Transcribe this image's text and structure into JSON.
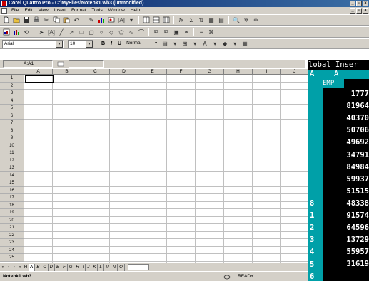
{
  "window": {
    "title": "Corel Quattro Pro - C:\\MyFiles\\Notebk1.wb3 (unmodified)"
  },
  "menu": [
    "File",
    "Edit",
    "View",
    "Insert",
    "Format",
    "Tools",
    "Window",
    "Help"
  ],
  "font_bar": {
    "font": "Arial",
    "size": "10",
    "bold": "B",
    "italic": "I",
    "underline": "U",
    "style": "Normal"
  },
  "input_line": {
    "cell_ref": "A:A1",
    "value": ""
  },
  "columns": [
    "A",
    "B",
    "C",
    "D",
    "E",
    "F",
    "G",
    "H",
    "I",
    "J"
  ],
  "rows": [
    "1",
    "2",
    "3",
    "4",
    "5",
    "6",
    "7",
    "8",
    "9",
    "10",
    "11",
    "12",
    "13",
    "14",
    "15",
    "16",
    "17",
    "18",
    "19",
    "20",
    "21",
    "22",
    "23",
    "24",
    "25"
  ],
  "sheet_tabs": [
    "A",
    "B",
    "C",
    "D",
    "E",
    "F",
    "G",
    "H",
    "I",
    "J",
    "K",
    "L",
    "M",
    "N",
    "O"
  ],
  "sheet_nav": [
    "«",
    "‹",
    "›",
    "»",
    "H"
  ],
  "status": {
    "notebook": "Notebk1.wb3",
    "mode": "READY"
  },
  "dos_overlay": {
    "header": "lobal  Inser",
    "col_label": "A",
    "row_marker": "A",
    "field_name": "EMP",
    "values": [
      "1777",
      "81964",
      "40370",
      "50706",
      "49692",
      "34791",
      "84984",
      "59937",
      "51515",
      "48338",
      "91574",
      "64596",
      "13729",
      "55957",
      "31619"
    ],
    "line_numbers": [
      "8",
      "1",
      "2",
      "3",
      "4",
      "5",
      "6"
    ]
  }
}
